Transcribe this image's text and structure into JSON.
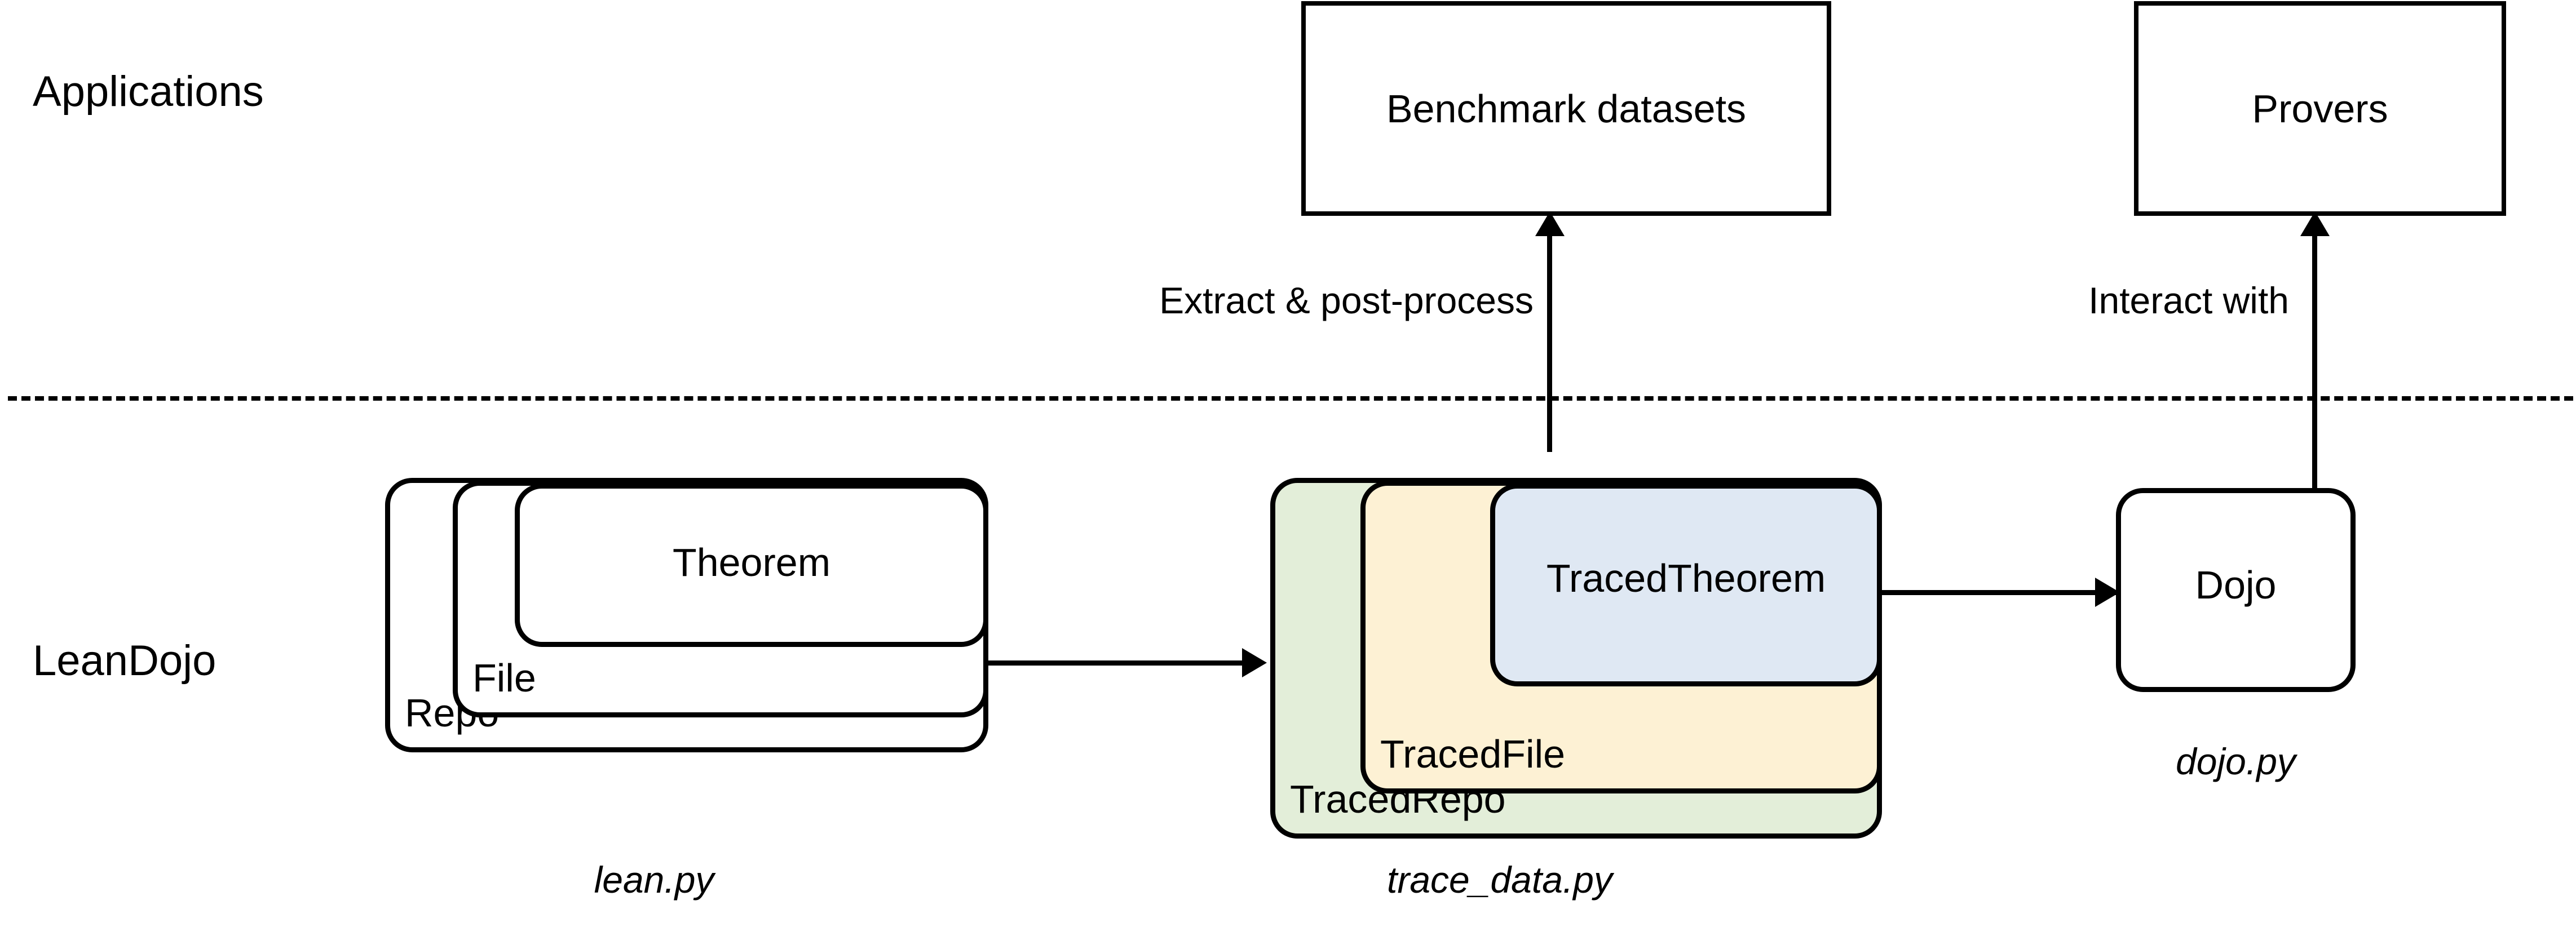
{
  "figure": {
    "kind": "architecture-diagram",
    "background": "#ffffff",
    "stroke_color": "#000000"
  },
  "layers": [
    {
      "id": "applications",
      "label": "Applications"
    },
    {
      "id": "leandojo",
      "label": "LeanDojo"
    }
  ],
  "applications": {
    "boxes": [
      {
        "id": "benchmark-datasets",
        "label": "Benchmark datasets"
      },
      {
        "id": "provers",
        "label": "Provers"
      }
    ]
  },
  "leandojo": {
    "lean_group": {
      "caption": "lean.py",
      "levels": [
        {
          "id": "repo",
          "label": "Repo",
          "fill": "#ffffff"
        },
        {
          "id": "file",
          "label": "File",
          "fill": "#ffffff"
        },
        {
          "id": "theorem",
          "label": "Theorem",
          "fill": "#ffffff"
        }
      ]
    },
    "traced_group": {
      "caption": "trace_data.py",
      "levels": [
        {
          "id": "traced-repo",
          "label": "TracedRepo",
          "fill": "#e3eed9"
        },
        {
          "id": "traced-file",
          "label": "TracedFile",
          "fill": "#fdf1d4"
        },
        {
          "id": "traced-theorem",
          "label": "TracedTheorem",
          "fill": "#dfe8f3"
        }
      ]
    },
    "dojo": {
      "label": "Dojo",
      "caption": "dojo.py",
      "fill": "#ffffff"
    }
  },
  "edges": [
    {
      "id": "theorem-to-tracedrepo",
      "label": "",
      "from": "Theorem",
      "to": "TracedRepo",
      "direction": "right"
    },
    {
      "id": "tracedtheorem-to-dojo",
      "label": "",
      "from": "TracedTheorem",
      "to": "Dojo",
      "direction": "right"
    },
    {
      "id": "tracedtheorem-to-benchmark",
      "label": "Extract & post-process",
      "from": "TracedTheorem",
      "to": "Benchmark datasets",
      "direction": "up"
    },
    {
      "id": "dojo-to-provers",
      "label": "Interact with",
      "from": "Dojo",
      "to": "Provers",
      "direction": "up"
    }
  ],
  "colors": {
    "traced_repo_fill": "#e3eed9",
    "traced_file_fill": "#fdf1d4",
    "traced_theorem_fill": "#dfe8f3",
    "stroke": "#000000",
    "background": "#ffffff"
  }
}
